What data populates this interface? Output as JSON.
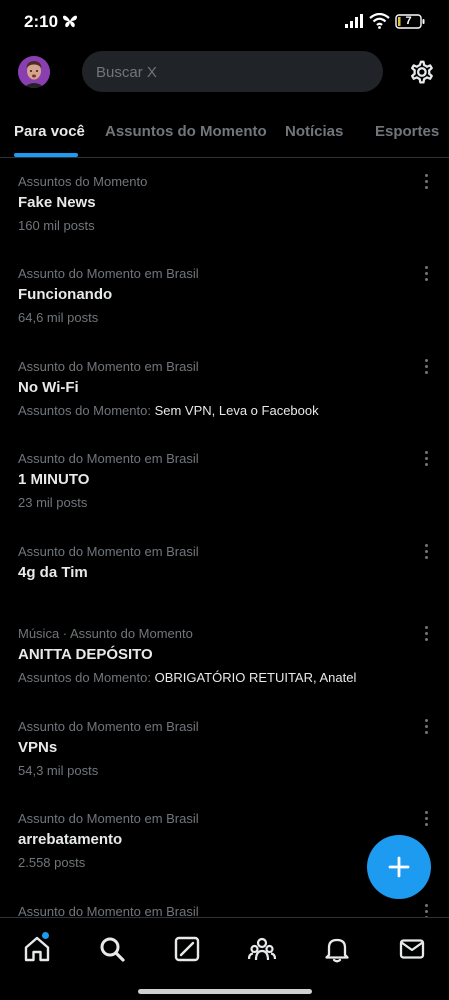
{
  "status_bar": {
    "time": "2:10",
    "battery": "7"
  },
  "header": {
    "search_placeholder": "Buscar X"
  },
  "tabs": [
    {
      "label": "Para você",
      "active": true
    },
    {
      "label": "Assuntos do Momento",
      "active": false
    },
    {
      "label": "Notícias",
      "active": false
    },
    {
      "label": "Esportes",
      "active": false
    }
  ],
  "trends": [
    {
      "context": "Assuntos do Momento",
      "title": "Fake News",
      "meta": "160 mil posts"
    },
    {
      "context": "Assunto do Momento em Brasil",
      "title": "Funcionando",
      "meta": "64,6 mil posts"
    },
    {
      "context": "Assunto do Momento em Brasil",
      "title": "No Wi-Fi",
      "meta_label": "Assuntos do Momento: ",
      "meta_value": "Sem VPN, Leva o Facebook"
    },
    {
      "context": "Assunto do Momento em Brasil",
      "title": "1 MINUTO",
      "meta": "23 mil posts"
    },
    {
      "context": "Assunto do Momento em Brasil",
      "title": "4g da Tim",
      "meta": ""
    },
    {
      "context": "Música · Assunto do Momento",
      "title": "ANITTA DEPÓSITO",
      "meta_label": "Assuntos do Momento: ",
      "meta_value": "OBRIGATÓRIO RETUITAR, Anatel"
    },
    {
      "context": "Assunto do Momento em Brasil",
      "title": "VPNs",
      "meta": "54,3 mil posts"
    },
    {
      "context": "Assunto do Momento em Brasil",
      "title": "arrebatamento",
      "meta": "2.558 posts"
    },
    {
      "context": "Assunto do Momento em Brasil",
      "title": "",
      "meta": ""
    }
  ],
  "icons": {
    "settings": "gear-icon",
    "fab": "plus-icon",
    "nav": [
      "home-icon",
      "search-icon",
      "grok-icon",
      "communities-icon",
      "bell-icon",
      "mail-icon"
    ]
  },
  "colors": {
    "accent": "#1d9bf0",
    "background": "#000000",
    "muted": "#71767b",
    "text": "#e7e9ea"
  }
}
